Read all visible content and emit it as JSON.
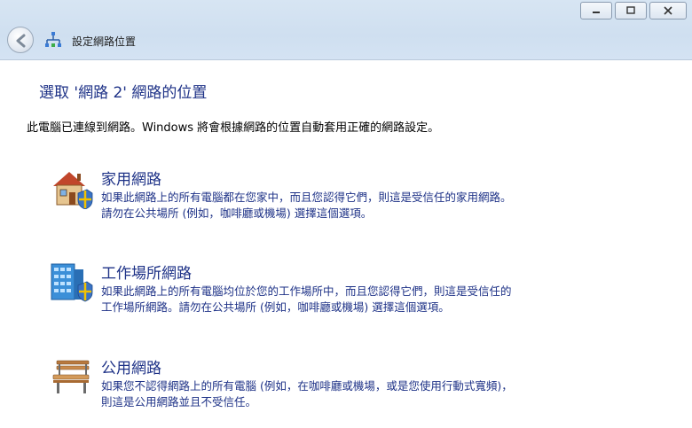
{
  "window": {
    "title": "設定網路位置",
    "caption_minimize": "▭",
    "caption_maximize": "□",
    "caption_close": "✕"
  },
  "main": {
    "heading": "選取 '網路  2' 網路的位置",
    "description": "此電腦已連線到網路。Windows 將會根據網路的位置自動套用正確的網路設定。",
    "options": [
      {
        "title": "家用網路",
        "line1": "如果此網路上的所有電腦都在您家中，而且您認得它們，則這是受信任的家用網路。",
        "line2": "請勿在公共場所 (例如，咖啡廳或機場) 選擇這個選項。",
        "icon": "home-network-icon"
      },
      {
        "title": "工作場所網路",
        "line1": "如果此網路上的所有電腦均位於您的工作場所中，而且您認得它們，則這是受信任的",
        "line2": "工作場所網路。請勿在公共場所 (例如，咖啡廳或機場) 選擇這個選項。",
        "icon": "work-network-icon"
      },
      {
        "title": "公用網路",
        "line1": "如果您不認得網路上的所有電腦 (例如，在咖啡廳或機場，或是您使用行動式寬頻)，",
        "line2": "則這是公用網路並且不受信任。",
        "icon": "public-network-icon"
      }
    ]
  },
  "colors": {
    "link_blue": "#1e3287",
    "titlebar": "#d4e3f3"
  }
}
